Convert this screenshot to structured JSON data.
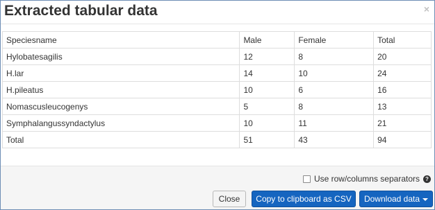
{
  "dialog": {
    "title": "Extracted tabular data",
    "close_glyph": "×"
  },
  "table": {
    "headers": [
      "Speciesname",
      "Male",
      "Female",
      "Total"
    ],
    "rows": [
      [
        "Hylobatesagilis",
        "12",
        "8",
        "20"
      ],
      [
        "H.lar",
        "14",
        "10",
        "24"
      ],
      [
        "H.pileatus",
        "10",
        "6",
        "16"
      ],
      [
        "Nomascusleucogenys",
        "5",
        "8",
        "13"
      ],
      [
        "Symphalangussyndactylus",
        "10",
        "11",
        "21"
      ],
      [
        "Total",
        "51",
        "43",
        "94"
      ]
    ]
  },
  "footer": {
    "separator_label": "Use row/columns separators",
    "separator_checked": false,
    "help_glyph": "?",
    "close_label": "Close",
    "copy_label": "Copy to clipboard as CSV",
    "download_label": "Download data"
  },
  "colors": {
    "primary_button": "#1565c0",
    "footer_background": "#f5f5f5",
    "frame_border": "#6d8db5"
  }
}
